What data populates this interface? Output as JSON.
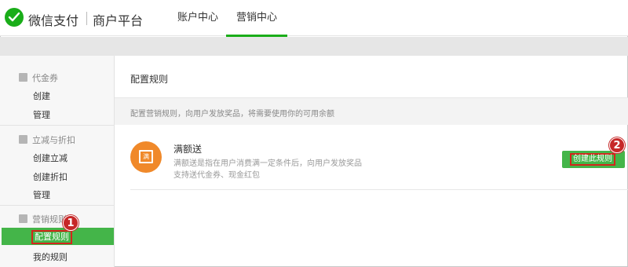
{
  "header": {
    "brand": "微信支付",
    "brand_sub": "商户平台",
    "nav": [
      {
        "label": "账户中心"
      },
      {
        "label": "营销中心"
      }
    ],
    "active_nav": "营销中心",
    "accent_color": "#1aad19"
  },
  "sidebar": {
    "groups": [
      {
        "title": "代金券",
        "icon": "coupon-icon",
        "items": [
          "创建",
          "管理"
        ]
      },
      {
        "title": "立减与折扣",
        "icon": "discount-icon",
        "items": [
          "创建立减",
          "创建折扣",
          "管理"
        ]
      },
      {
        "title": "营销规则",
        "icon": "gift-icon",
        "items": [
          "配置规则",
          "我的规则"
        ]
      }
    ],
    "active_item": "配置规则",
    "active_color": "#44b549"
  },
  "main": {
    "title": "配置规则",
    "description": "配置营销规则，向用户发放奖品，将需要使用你的可用余额",
    "rule": {
      "icon_char": "满",
      "name": "满额送",
      "desc_line1": "满额送是指在用户消费满一定条件后，向用户发放奖品",
      "desc_line2": "支持送代金券、现金红包",
      "button_label": "创建此规则"
    }
  },
  "annotations": {
    "step1": "1",
    "step2": "2",
    "highlight_color": "#d3251c"
  }
}
